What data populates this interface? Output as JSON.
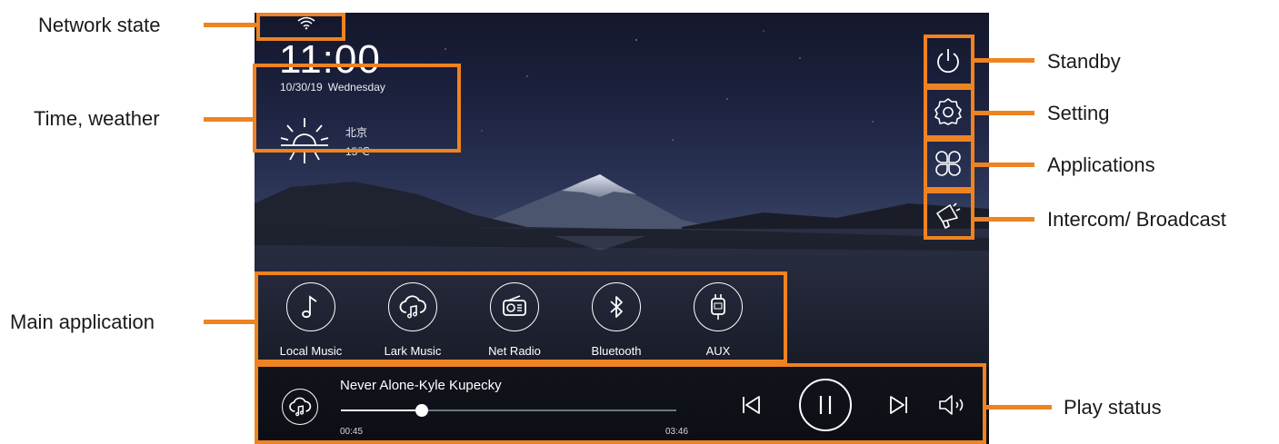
{
  "status": {
    "network_icon": "wifi-icon"
  },
  "clock": {
    "time": "11:00",
    "date": "10/30/19",
    "weekday": "Wednesday"
  },
  "weather": {
    "icon": "sun-icon",
    "city": "北京",
    "temperature": "15℃"
  },
  "side_buttons": [
    {
      "name": "standby",
      "icon": "power-icon"
    },
    {
      "name": "setting",
      "icon": "gear-icon"
    },
    {
      "name": "applications",
      "icon": "app-grid-icon"
    },
    {
      "name": "intercom",
      "icon": "megaphone-icon"
    }
  ],
  "apps": [
    {
      "label": "Local Music",
      "icon": "music-note-icon"
    },
    {
      "label": "Lark Music",
      "icon": "cloud-music-icon"
    },
    {
      "label": "Net Radio",
      "icon": "radio-icon"
    },
    {
      "label": "Bluetooth",
      "icon": "bluetooth-icon"
    },
    {
      "label": "AUX",
      "icon": "aux-plug-icon"
    }
  ],
  "player": {
    "song": "Never Alone-Kyle Kupecky",
    "elapsed": "00:45",
    "total": "03:46",
    "progress": 0.24,
    "source_icon": "cloud-music-icon",
    "state": "playing"
  },
  "callouts": {
    "network": "Network state",
    "time_weather": "Time, weather",
    "main_app": "Main application",
    "standby": "Standby",
    "setting": "Setting",
    "applications": "Applications",
    "intercom": "Intercom/ Broadcast",
    "play_status": "Play status"
  },
  "colors": {
    "accent": "#ee8322",
    "screen_top": "#14172b",
    "screen_bottom": "#15171f"
  }
}
